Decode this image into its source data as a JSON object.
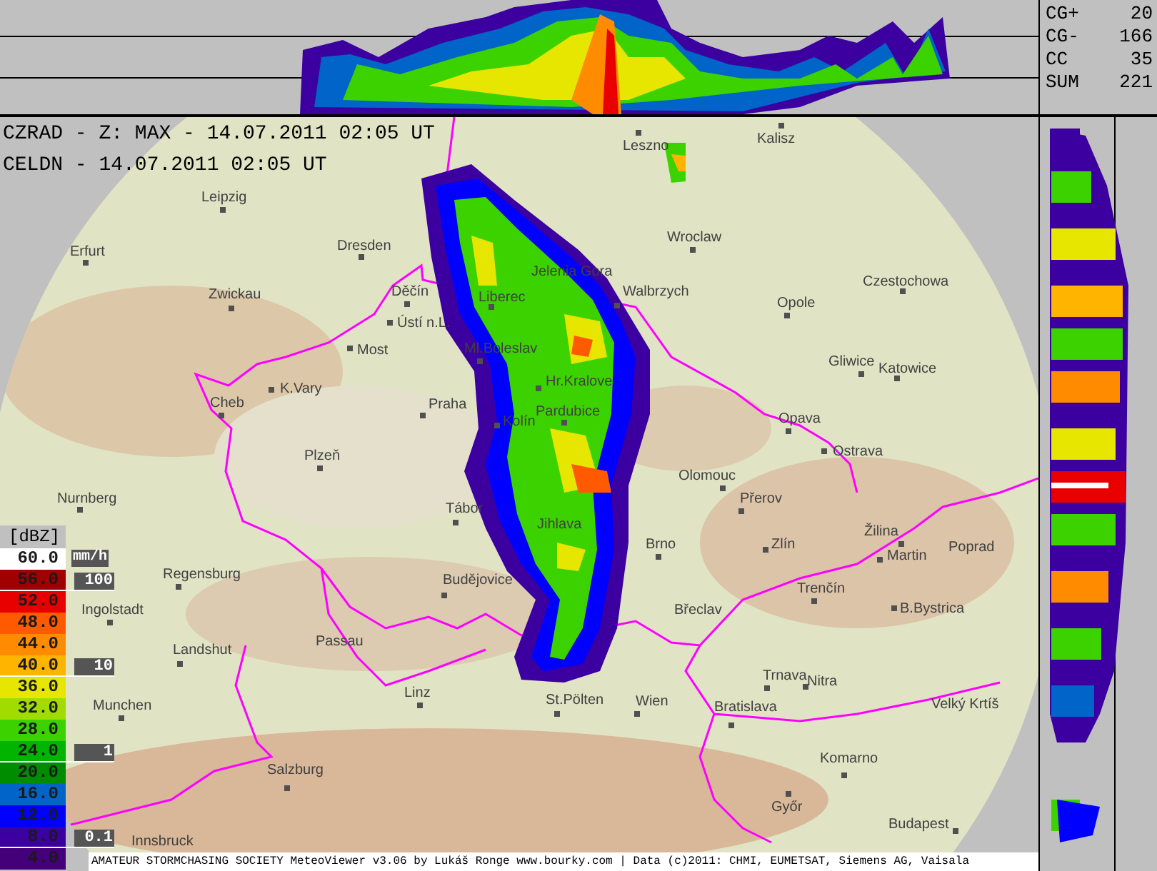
{
  "header": {
    "lines": [
      "CZRAD - Z: MAX - 14.07.2011 02:05 UT",
      "CELDN - 14.07.2011 02:05 UT"
    ]
  },
  "lightning_stats": [
    {
      "label": "CG+",
      "value": "20"
    },
    {
      "label": "CG-",
      "value": "166"
    },
    {
      "label": "CC",
      "value": "35"
    },
    {
      "label": "SUM",
      "value": "221"
    }
  ],
  "cities": [
    {
      "name": "Leszno"
    },
    {
      "name": "Kalisz"
    },
    {
      "name": "Leipzig"
    },
    {
      "name": "Erfurt"
    },
    {
      "name": "Dresden"
    },
    {
      "name": "Zwickau"
    },
    {
      "name": "Děčín"
    },
    {
      "name": "Ústí n.L."
    },
    {
      "name": "Most"
    },
    {
      "name": "K.Vary"
    },
    {
      "name": "Cheb"
    },
    {
      "name": "Plzeň"
    },
    {
      "name": "Nurnberg"
    },
    {
      "name": "Tábor"
    },
    {
      "name": "Praha"
    },
    {
      "name": "Liberec"
    },
    {
      "name": "Ml.Boleslav"
    },
    {
      "name": "Jelenia Gora"
    },
    {
      "name": "Walbrzych"
    },
    {
      "name": "Hr.Kralove"
    },
    {
      "name": "Pardubice"
    },
    {
      "name": "Kolín"
    },
    {
      "name": "Jihlava"
    },
    {
      "name": "Wroclaw"
    },
    {
      "name": "Opole"
    },
    {
      "name": "Czestochowa"
    },
    {
      "name": "Gliwice"
    },
    {
      "name": "Katowice"
    },
    {
      "name": "Opava"
    },
    {
      "name": "Ostrava"
    },
    {
      "name": "Olomouc"
    },
    {
      "name": "Přerov"
    },
    {
      "name": "Brno"
    },
    {
      "name": "Zlín"
    },
    {
      "name": "Žilina"
    },
    {
      "name": "Martin"
    },
    {
      "name": "Poprad"
    },
    {
      "name": "Trenčín"
    },
    {
      "name": "Břeclav"
    },
    {
      "name": "B.Bystrica"
    },
    {
      "name": "Regensburg"
    },
    {
      "name": "Ingolstadt"
    },
    {
      "name": "Landshut"
    },
    {
      "name": "Passau"
    },
    {
      "name": "Budějovice"
    },
    {
      "name": "Trnava"
    },
    {
      "name": "Nitra"
    },
    {
      "name": "Munchen"
    },
    {
      "name": "Linz"
    },
    {
      "name": "St.Pölten"
    },
    {
      "name": "Wien"
    },
    {
      "name": "Bratislava"
    },
    {
      "name": "Velký Krtíš"
    },
    {
      "name": "Salzburg"
    },
    {
      "name": "Komarno"
    },
    {
      "name": "Győr"
    },
    {
      "name": "Budapest"
    },
    {
      "name": "Innsbruck"
    }
  ],
  "legend": {
    "unit": "[dBZ]",
    "rain_unit": "mm/h",
    "levels": [
      {
        "label": "60.0",
        "color": "#ffffff"
      },
      {
        "label": "56.0",
        "color": "#a00000"
      },
      {
        "label": "52.0",
        "color": "#e80000"
      },
      {
        "label": "48.0",
        "color": "#ff5a00"
      },
      {
        "label": "44.0",
        "color": "#ff8c00"
      },
      {
        "label": "40.0",
        "color": "#ffb400"
      },
      {
        "label": "36.0",
        "color": "#e6e600"
      },
      {
        "label": "32.0",
        "color": "#a0dc00"
      },
      {
        "label": "28.0",
        "color": "#3cd200"
      },
      {
        "label": "24.0",
        "color": "#00b400"
      },
      {
        "label": "20.0",
        "color": "#008c00"
      },
      {
        "label": "16.0",
        "color": "#0064c8"
      },
      {
        "label": "12.0",
        "color": "#0000ff"
      },
      {
        "label": "8.0",
        "color": "#3c00a0"
      },
      {
        "label": "4.0",
        "color": "#440078"
      }
    ],
    "rain_marks": [
      "100",
      "10",
      "1",
      "0.1"
    ]
  },
  "footer": "AMATEUR STORMCHASING SOCIETY MeteoViewer v3.06 by Lukáš Ronge www.bourky.com | Data (c)2011: CHMI, EUMETSAT, Siemens AG, Vaisala"
}
